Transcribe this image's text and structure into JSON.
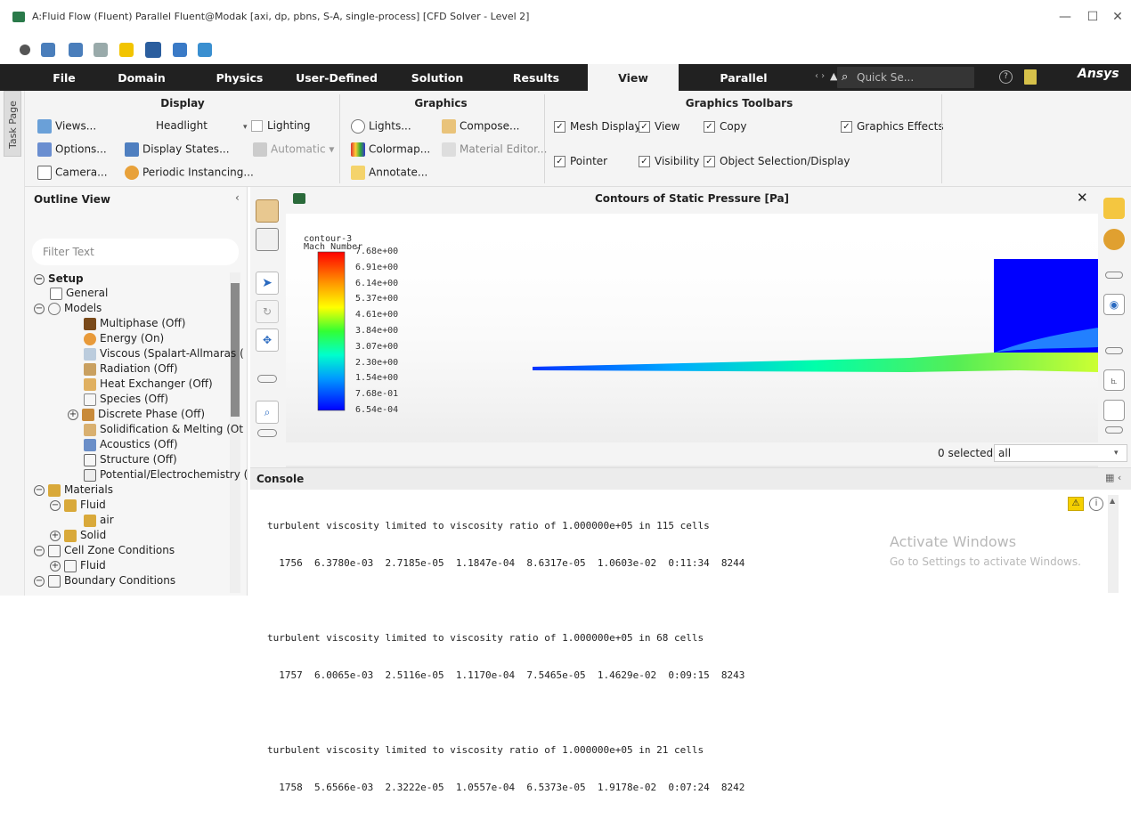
{
  "window": {
    "title": "A:Fluid Flow (Fluent) Parallel Fluent@Modak  [axi, dp, pbns, S-A, single-process] [CFD Solver - Level 2]",
    "minimize": "—",
    "maximize": "☐",
    "close": "✕"
  },
  "menu": {
    "items": [
      "File",
      "Domain",
      "Physics",
      "User-Defined",
      "Solution",
      "Results",
      "View",
      "Parallel"
    ],
    "active": "View",
    "search_placeholder": "Quick Se...",
    "brand": "Ansys"
  },
  "ribbon": {
    "display": {
      "title": "Display",
      "views": "Views...",
      "headlight": "Headlight",
      "lighting": "Lighting",
      "options": "Options...",
      "display_states": "Display States...",
      "automatic": "Automatic",
      "camera": "Camera...",
      "periodic": "Periodic Instancing..."
    },
    "graphics": {
      "title": "Graphics",
      "lights": "Lights...",
      "compose": "Compose...",
      "colormap": "Colormap...",
      "material_editor": "Material Editor...",
      "annotate": "Annotate..."
    },
    "toolbars": {
      "title": "Graphics Toolbars",
      "mesh_display": "Mesh Display",
      "view": "View",
      "copy": "Copy",
      "graphics_effects": "Graphics Effects",
      "pointer": "Pointer",
      "visibility": "Visibility",
      "object_selection": "Object Selection/Display"
    }
  },
  "taskpage": {
    "label": "Task Page"
  },
  "outline": {
    "title": "Outline View",
    "filter_placeholder": "Filter Text",
    "tree": [
      {
        "label": "Setup",
        "bold": true
      },
      {
        "label": "General"
      },
      {
        "label": "Models"
      },
      {
        "label": "Multiphase (Off)"
      },
      {
        "label": "Energy (On)"
      },
      {
        "label": "Viscous (Spalart-Allmaras ("
      },
      {
        "label": "Radiation (Off)"
      },
      {
        "label": "Heat Exchanger (Off)"
      },
      {
        "label": "Species (Off)"
      },
      {
        "label": "Discrete Phase (Off)"
      },
      {
        "label": "Solidification & Melting (Ot"
      },
      {
        "label": "Acoustics (Off)"
      },
      {
        "label": "Structure (Off)"
      },
      {
        "label": "Potential/Electrochemistry ("
      },
      {
        "label": "Materials"
      },
      {
        "label": "Fluid"
      },
      {
        "label": "air"
      },
      {
        "label": "Solid"
      },
      {
        "label": "Cell Zone Conditions"
      },
      {
        "label": "Fluid"
      },
      {
        "label": "Boundary Conditions"
      }
    ]
  },
  "graphics": {
    "title": "Contours of Static Pressure [Pa]",
    "legend_name": "contour-3",
    "legend_var": "Mach Number",
    "legend_values": [
      "7.68e+00",
      "6.91e+00",
      "6.14e+00",
      "5.37e+00",
      "4.61e+00",
      "3.84e+00",
      "3.07e+00",
      "2.30e+00",
      "1.54e+00",
      "7.68e-01",
      "6.54e-04"
    ],
    "selected_count": "0 selected",
    "selected_filter": "all"
  },
  "console": {
    "title": "Console",
    "lines": [
      "turbulent viscosity limited to viscosity ratio of 1.000000e+05 in 115 cells",
      "  1756  6.3780e-03  2.7185e-05  1.1847e-04  8.6317e-05  1.0603e-02  0:11:34  8244",
      "",
      "turbulent viscosity limited to viscosity ratio of 1.000000e+05 in 68 cells",
      "  1757  6.0065e-03  2.5116e-05  1.1170e-04  7.5465e-05  1.4629e-02  0:09:15  8243",
      "",
      "turbulent viscosity limited to viscosity ratio of 1.000000e+05 in 21 cells",
      "  1758  5.6566e-03  2.3222e-05  1.0557e-04  6.5373e-05  1.9178e-02  0:07:24  8242"
    ],
    "watermark_title": "Activate Windows",
    "watermark_sub": "Go to Settings to activate Windows."
  }
}
